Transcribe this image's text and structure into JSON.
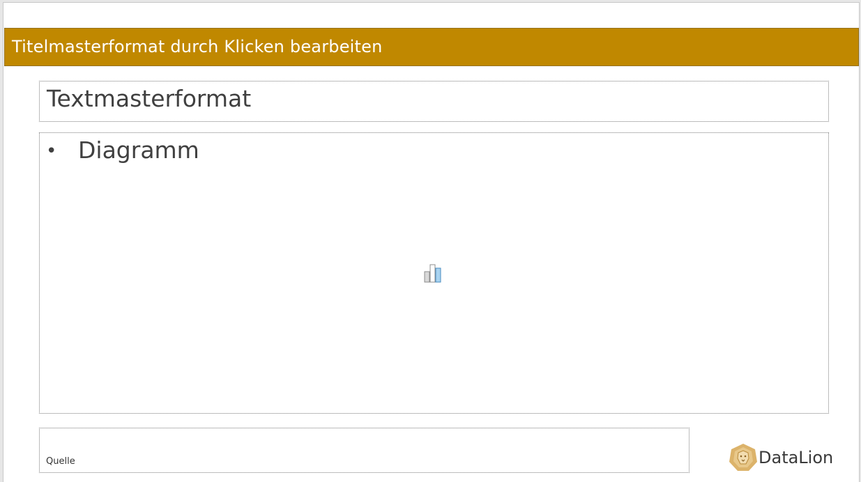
{
  "slide": {
    "title": "Titelmasterformat durch Klicken bearbeiten",
    "subtitle": "Textmasterformat",
    "content": {
      "bullet": "•",
      "text": "Diagramm",
      "placeholder_icon": "chart-icon"
    },
    "source_label": "Quelle"
  },
  "logo": {
    "text": "DataLion",
    "icon": "lion-head-icon"
  },
  "colors": {
    "title_bar": "#c08800",
    "title_text": "#ffffff",
    "body_text": "#404040",
    "logo_accent": "#d4a85a"
  }
}
